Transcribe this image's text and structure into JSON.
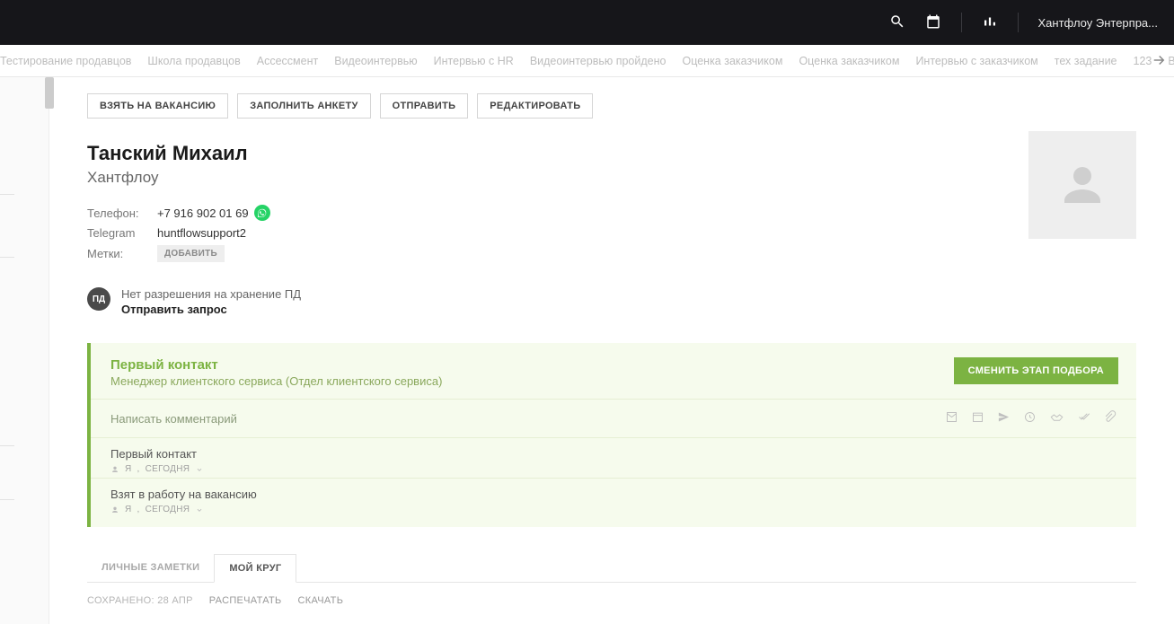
{
  "header": {
    "org_name": "Хантфлоу Энтерпра..."
  },
  "stages": [
    "Тестирование продавцов",
    "Школа продавцов",
    "Ассессмент",
    "Видеоинтервью",
    "Интервью с HR",
    "Видеоинтервью пройдено",
    "Оценка заказчиком",
    "Оценка заказчиком",
    "Интервью с заказчиком",
    "тех задание",
    "123",
    "Вы"
  ],
  "actions": {
    "take_vacancy": "ВЗЯТЬ НА ВАКАНСИЮ",
    "fill_form": "ЗАПОЛНИТЬ АНКЕТУ",
    "send": "ОТПРАВИТЬ",
    "edit": "РЕДАКТИРОВАТЬ"
  },
  "candidate": {
    "name": "Танский Михаил",
    "company": "Хантфлоу"
  },
  "contacts": {
    "phone_label": "Телефон:",
    "phone_value": "+7 916 902 01 69",
    "telegram_label": "Telegram",
    "telegram_value": "huntflowsupport2",
    "tags_label": "Метки:",
    "add_tag": "ДОБАВИТЬ"
  },
  "pd": {
    "badge": "ПД",
    "line1": "Нет разрешения на хранение ПД",
    "line2": "Отправить запрос"
  },
  "stage_card": {
    "title": "Первый контакт",
    "subtitle": "Менеджер клиентского сервиса (Отдел клиентского сервиса)",
    "change_btn": "СМЕНИТЬ ЭТАП ПОДБОРА",
    "comment_placeholder": "Написать комментарий"
  },
  "log": [
    {
      "title": "Первый контакт",
      "author": "Я",
      "when": "СЕГОДНЯ"
    },
    {
      "title": "Взят в работу на вакансию",
      "author": "Я",
      "when": "СЕГОДНЯ"
    }
  ],
  "tabs": {
    "notes": "ЛИЧНЫЕ ЗАМЕТКИ",
    "circle": "МОЙ КРУГ"
  },
  "footer": {
    "saved": "СОХРАНЕНО: 28 АПР",
    "print": "РАСПЕЧАТАТЬ",
    "download": "СКАЧАТЬ"
  }
}
